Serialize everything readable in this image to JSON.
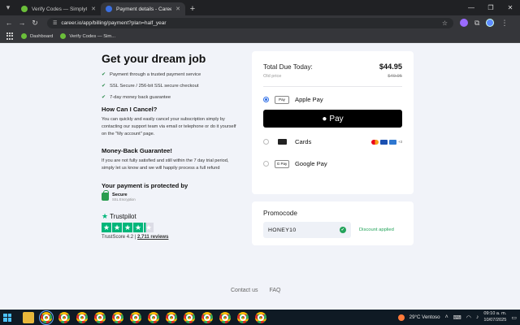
{
  "browser": {
    "tabs": [
      {
        "title": "Verify Codes — SimplyCodes",
        "active": false
      },
      {
        "title": "Payment details - Career.io",
        "active": true
      }
    ],
    "url": "career.io/app/billing/payment?plan=half_year",
    "bookmarks": [
      "Dashboard",
      "Verify Codes — Sim..."
    ]
  },
  "left": {
    "title": "Get your dream job",
    "bullets": [
      "Payment through a trusted payment service",
      "SSL Secure / 256-bit SSL secure checkout",
      "7-day money back guarantee"
    ],
    "cancel_title": "How Can I Cancel?",
    "cancel_text": "You can quickly and easily cancel your subscription simply by contacting our support team via email or telephone or do it yourself on the \"My account\" page.",
    "guarantee_title": "Money-Back Guarantee!",
    "guarantee_text": "If you are not fully satisfied and still within the 7 day trial period, simply let us know and we will happily process a full refund",
    "protected_title": "Your payment is protected by",
    "secure_label": "Secure",
    "secure_sub": "SSL Encryption",
    "trustpilot": "Trustpilot",
    "trustscore": "TrustScore 4.2",
    "reviews": "2,711 reviews",
    "rating": 4.2
  },
  "payment": {
    "total_label": "Total Due Today:",
    "total_value": "$44.95",
    "old_label": "Old price",
    "old_value": "$49.95",
    "methods": [
      {
        "label": "Apple Pay",
        "icon": "Pay",
        "selected": true
      },
      {
        "label": "Cards",
        "selected": false
      },
      {
        "label": "Google Pay",
        "icon": "G Pay",
        "selected": false
      }
    ],
    "apple_button": "Pay",
    "cards_more": "+3"
  },
  "promo": {
    "title": "Promocode",
    "code": "HONEY10",
    "status": "Discount applied"
  },
  "footer": {
    "links": [
      "Contact us",
      "FAQ"
    ]
  },
  "taskbar": {
    "weather": "29°C  Ventoso",
    "time": "09:10 a. m.",
    "date": "10/07/2025"
  }
}
